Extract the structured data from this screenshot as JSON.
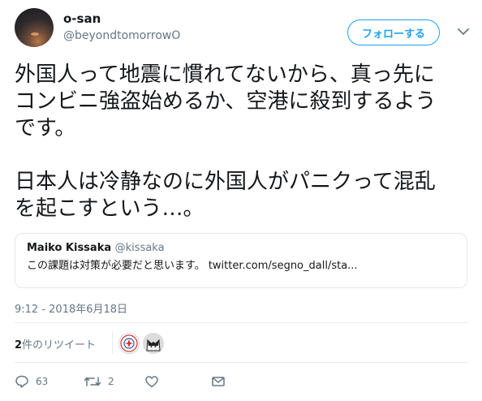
{
  "author": {
    "display_name": "o-san",
    "handle": "@beyondtomorrowO",
    "avatar_icon": "sunset-avatar"
  },
  "follow_button": {
    "label": "フォローする"
  },
  "tweet": {
    "text": "外国人って地震に慣れてないから、真っ先に\nコンビニ強盗始めるか、空港に殺到するよう\nです。\n\n日本人は冷静なのに外国人がパニクって混乱\nを起こすという…。"
  },
  "quote": {
    "author_name": "Maiko Kissaka",
    "author_handle": "@kissaka",
    "text": "この課題は対策が必要だと思います。 twitter.com/segno_dall/sta..."
  },
  "timestamp": "9:12 - 2018年6月18日",
  "retweets": {
    "count": "2",
    "label": "件のリツイート"
  },
  "actions": {
    "reply_count": "63",
    "retweet_count": "2"
  },
  "colors": {
    "accent": "#1da1f2",
    "muted": "#657786",
    "text": "#14171a",
    "border": "#e1e8ed"
  }
}
